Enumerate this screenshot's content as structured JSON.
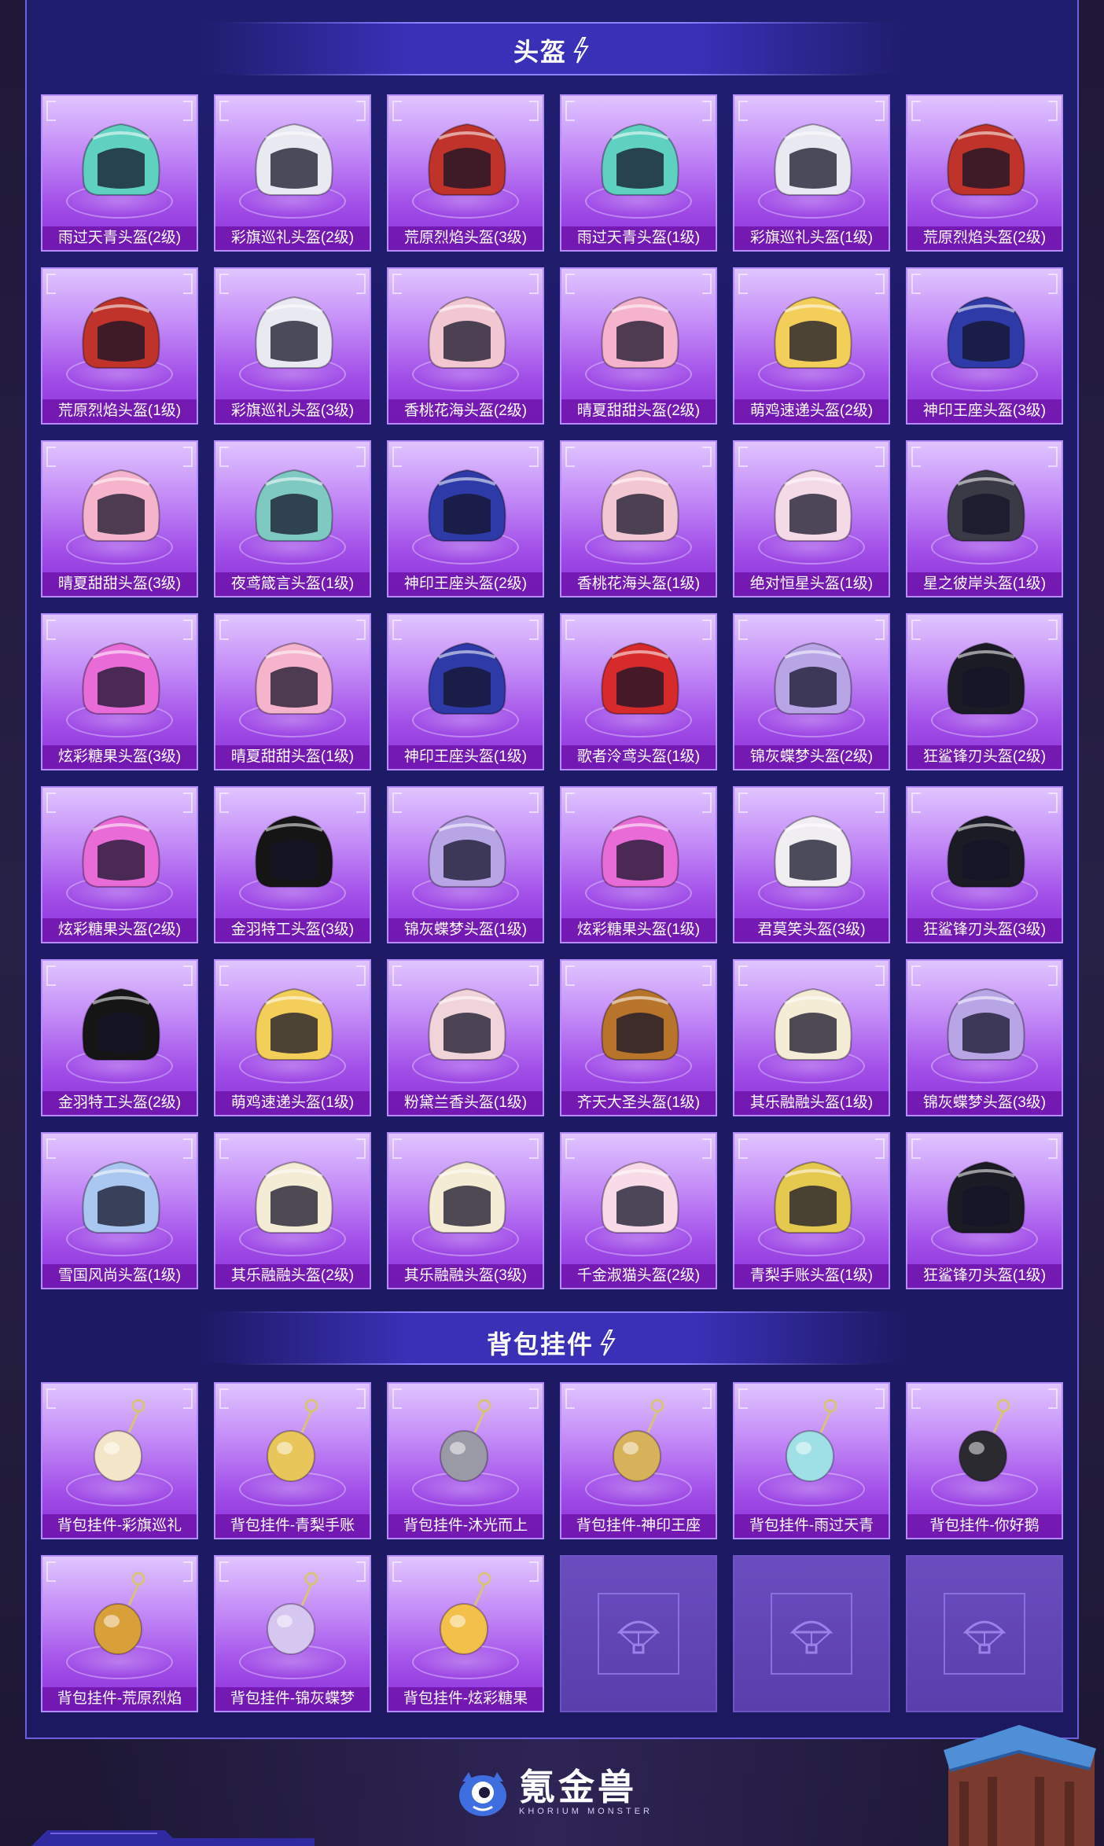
{
  "helmet_section": {
    "title": "头盔",
    "items": [
      {
        "label": "雨过天青头盔(2级)",
        "color": "#5fd1c0"
      },
      {
        "label": "彩旗巡礼头盔(2级)",
        "color": "#e9e9f2"
      },
      {
        "label": "荒原烈焰头盔(3级)",
        "color": "#c0332b"
      },
      {
        "label": "雨过天青头盔(1级)",
        "color": "#5fd1c0"
      },
      {
        "label": "彩旗巡礼头盔(1级)",
        "color": "#e9e9f2"
      },
      {
        "label": "荒原烈焰头盔(2级)",
        "color": "#c0332b"
      },
      {
        "label": "荒原烈焰头盔(1级)",
        "color": "#c0332b"
      },
      {
        "label": "彩旗巡礼头盔(3级)",
        "color": "#e9e9f2"
      },
      {
        "label": "香桃花海头盔(2级)",
        "color": "#f3c7d2"
      },
      {
        "label": "晴夏甜甜头盔(2级)",
        "color": "#f6b4cc"
      },
      {
        "label": "萌鸡速递头盔(2级)",
        "color": "#f3cf5a"
      },
      {
        "label": "神印王座头盔(3级)",
        "color": "#2d3aa8"
      },
      {
        "label": "晴夏甜甜头盔(3级)",
        "color": "#f6b4cc"
      },
      {
        "label": "夜鸢箴言头盔(1级)",
        "color": "#7fc9c3"
      },
      {
        "label": "神印王座头盔(2级)",
        "color": "#2d3aa8"
      },
      {
        "label": "香桃花海头盔(1级)",
        "color": "#f3c7d2"
      },
      {
        "label": "绝对恒星头盔(1级)",
        "color": "#f4d9e6"
      },
      {
        "label": "星之彼岸头盔(1级)",
        "color": "#3a3a46"
      },
      {
        "label": "炫彩糖果头盔(3级)",
        "color": "#e96bd8"
      },
      {
        "label": "晴夏甜甜头盔(1级)",
        "color": "#f6b4cc"
      },
      {
        "label": "神印王座头盔(1级)",
        "color": "#2d3aa8"
      },
      {
        "label": "歌者泠鸢头盔(1级)",
        "color": "#d72a2a"
      },
      {
        "label": "锦灰蝶梦头盔(2级)",
        "color": "#b7a5e6"
      },
      {
        "label": "狂鲨锋刃头盔(2级)",
        "color": "#1b1b26"
      },
      {
        "label": "炫彩糖果头盔(2级)",
        "color": "#e96bd8"
      },
      {
        "label": "金羽特工头盔(3级)",
        "color": "#151515"
      },
      {
        "label": "锦灰蝶梦头盔(1级)",
        "color": "#b7a5e6"
      },
      {
        "label": "炫彩糖果头盔(1级)",
        "color": "#e96bd8"
      },
      {
        "label": "君莫笑头盔(3级)",
        "color": "#f1eef2"
      },
      {
        "label": "狂鲨锋刃头盔(3级)",
        "color": "#1b1b26"
      },
      {
        "label": "金羽特工头盔(2级)",
        "color": "#151515"
      },
      {
        "label": "萌鸡速递头盔(1级)",
        "color": "#f3cf5a"
      },
      {
        "label": "粉黛兰香头盔(1级)",
        "color": "#f1d3da"
      },
      {
        "label": "齐天大圣头盔(1级)",
        "color": "#b8742b"
      },
      {
        "label": "其乐融融头盔(1级)",
        "color": "#f5ecd6"
      },
      {
        "label": "锦灰蝶梦头盔(3级)",
        "color": "#b7a5e6"
      },
      {
        "label": "雪国风尚头盔(1级)",
        "color": "#a9c7f0"
      },
      {
        "label": "其乐融融头盔(2级)",
        "color": "#f5ecd6"
      },
      {
        "label": "其乐融融头盔(3级)",
        "color": "#f5ecd6"
      },
      {
        "label": "千金淑猫头盔(2级)",
        "color": "#f8dbe6"
      },
      {
        "label": "青梨手账头盔(1级)",
        "color": "#e5c94f"
      },
      {
        "label": "狂鲨锋刃头盔(1级)",
        "color": "#1b1b26"
      }
    ]
  },
  "backpack_section": {
    "title": "背包挂件",
    "items": [
      {
        "label": "背包挂件-彩旗巡礼",
        "color": "#f3e6c8"
      },
      {
        "label": "背包挂件-青梨手账",
        "color": "#e9c65a"
      },
      {
        "label": "背包挂件-沐光而上",
        "color": "#9a9aa6"
      },
      {
        "label": "背包挂件-神印王座",
        "color": "#d8b25a"
      },
      {
        "label": "背包挂件-雨过天青",
        "color": "#9fe0e6"
      },
      {
        "label": "背包挂件-你好鹅",
        "color": "#2a2a30"
      },
      {
        "label": "背包挂件-荒原烈焰",
        "color": "#d9a03a"
      },
      {
        "label": "背包挂件-锦灰蝶梦",
        "color": "#d6c7f0"
      },
      {
        "label": "背包挂件-炫彩糖果",
        "color": "#f3c04a"
      }
    ],
    "empty_slots": 3
  },
  "footer": {
    "brand": "氪金兽",
    "subtitle": "KHORIUM MONSTER"
  }
}
